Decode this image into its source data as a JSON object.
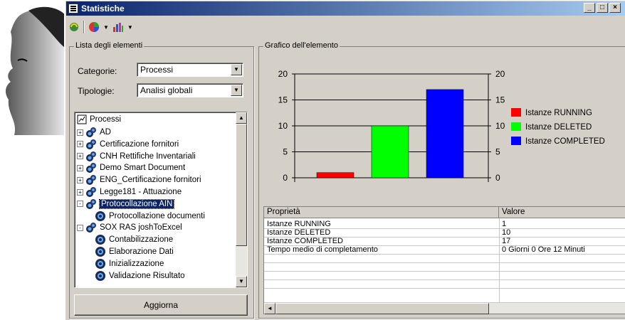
{
  "window": {
    "title": "Statistiche",
    "controls": [
      "_",
      "□",
      "×"
    ]
  },
  "toolbar": {
    "items": [
      "refresh-icon",
      "chart-pie-icon",
      "chart-bar-icon"
    ]
  },
  "left": {
    "group_title": "Lista degli elementi",
    "categorie_label": "Categorie:",
    "categorie_value": "Processi",
    "tipologie_label": "Tipologie:",
    "tipologie_value": "Analisi globali",
    "tree": {
      "root": "Processi",
      "items": [
        {
          "label": "AD",
          "expander": "+"
        },
        {
          "label": "Certificazione fornitori",
          "expander": "+"
        },
        {
          "label": "CNH Rettifiche Inventariali",
          "expander": "+"
        },
        {
          "label": "Demo Smart Document",
          "expander": "+"
        },
        {
          "label": "ENG_Certificazione fornitori",
          "expander": "+"
        },
        {
          "label": "Legge181 - Attuazione",
          "expander": "+"
        },
        {
          "label": "Protocollazione AIN",
          "expander": "-",
          "selected": true
        },
        {
          "label": "Protocollazione documenti",
          "child": true
        },
        {
          "label": "SOX RAS joshToExcel",
          "expander": "-"
        },
        {
          "label": "Contabilizzazione",
          "child": true
        },
        {
          "label": "Elaborazione Dati",
          "child": true
        },
        {
          "label": "Inizializzazione",
          "child": true
        },
        {
          "label": "Validazione Risultato",
          "child": true
        }
      ]
    },
    "refresh_button": "Aggiorna"
  },
  "right": {
    "group_title": "Grafico dell'elemento",
    "grid": {
      "headers": [
        "Proprietà",
        "Valore"
      ],
      "rows": [
        [
          "Istanze RUNNING",
          "1"
        ],
        [
          "Istanze DELETED",
          "10"
        ],
        [
          "Istanze COMPLETED",
          "17"
        ],
        [
          "Tempo medio di completamento",
          "0 Giorni 0 Ore 12 Minuti"
        ]
      ]
    }
  },
  "chart_data": {
    "type": "bar",
    "categories": [
      "Istanze RUNNING",
      "Istanze DELETED",
      "Istanze COMPLETED"
    ],
    "values": [
      1,
      10,
      17
    ],
    "colors": [
      "#ff0000",
      "#00ff00",
      "#0000ff"
    ],
    "ylim": [
      0,
      20
    ],
    "yticks": [
      0,
      5,
      10,
      15,
      20
    ],
    "legend_placement": "right",
    "grid": true
  }
}
